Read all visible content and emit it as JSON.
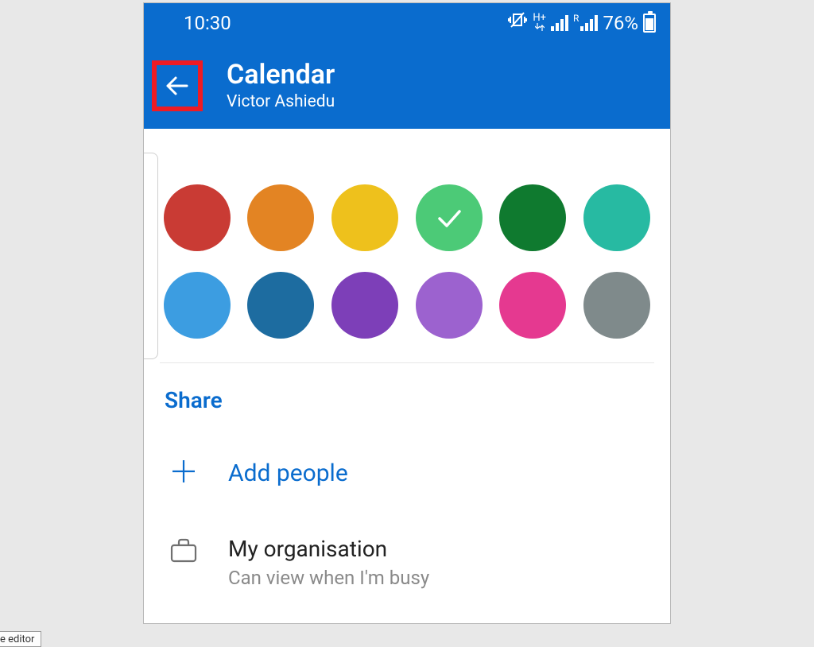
{
  "status": {
    "time": "10:30",
    "vibrate_icon": "vibrate",
    "data_indicator": "H+",
    "roaming_indicator": "R",
    "battery_pct": "76%"
  },
  "header": {
    "title": "Calendar",
    "subtitle": "Victor Ashiedu"
  },
  "colors": [
    {
      "hex": "#c93b34",
      "selected": false,
      "name": "red"
    },
    {
      "hex": "#e38423",
      "selected": false,
      "name": "orange"
    },
    {
      "hex": "#eec11c",
      "selected": false,
      "name": "yellow"
    },
    {
      "hex": "#4cca77",
      "selected": true,
      "name": "light-green"
    },
    {
      "hex": "#0f7a2f",
      "selected": false,
      "name": "green"
    },
    {
      "hex": "#27baa2",
      "selected": false,
      "name": "teal"
    },
    {
      "hex": "#3c9de1",
      "selected": false,
      "name": "light-blue"
    },
    {
      "hex": "#1d6ca0",
      "selected": false,
      "name": "blue"
    },
    {
      "hex": "#7d3fb8",
      "selected": false,
      "name": "purple"
    },
    {
      "hex": "#9c62cf",
      "selected": false,
      "name": "violet"
    },
    {
      "hex": "#e53990",
      "selected": false,
      "name": "pink"
    },
    {
      "hex": "#7f8a8b",
      "selected": false,
      "name": "grey"
    }
  ],
  "share": {
    "heading": "Share",
    "add_people": "Add people",
    "org_title": "My organisation",
    "org_sub": "Can view when I'm busy"
  },
  "editor_tab": "e editor"
}
